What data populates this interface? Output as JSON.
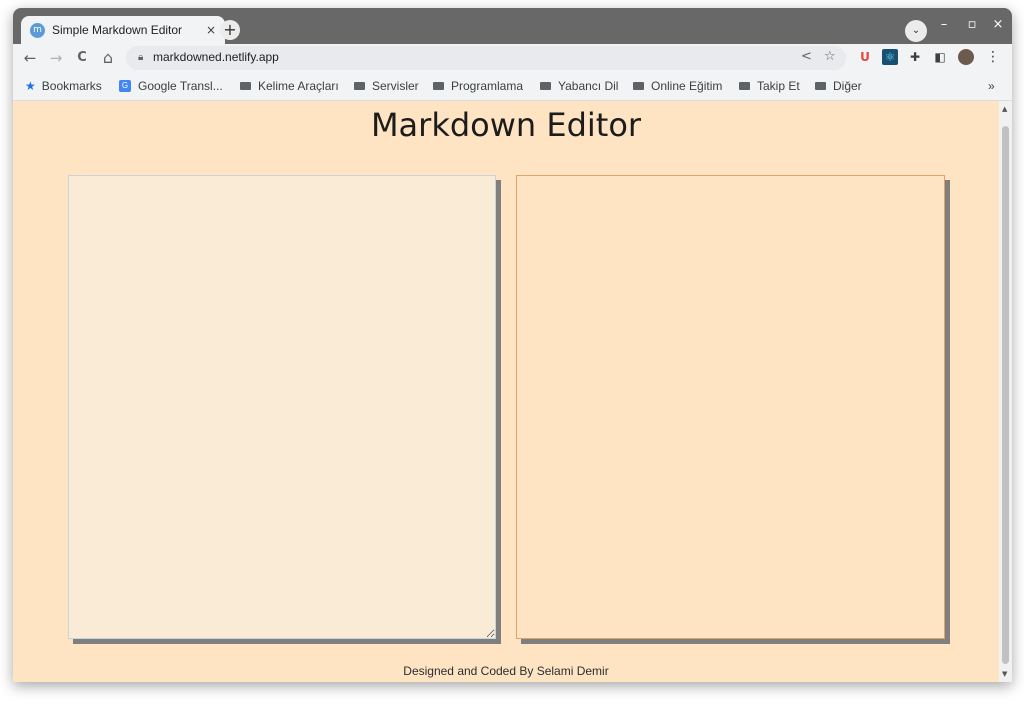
{
  "browser": {
    "tab": {
      "favicon": "m",
      "title": "Simple Markdown Editor",
      "close_glyph": "×"
    },
    "new_tab_glyph": "+",
    "tab_search_glyph": "⌄",
    "window_controls": {
      "minimize": "–",
      "maximize": "▫",
      "close": "×"
    },
    "toolbar": {
      "back_glyph": "←",
      "forward_glyph": "→",
      "reload_glyph": "C",
      "home_glyph": "⌂",
      "url": "markdowned.netlify.app",
      "share_glyph": "<",
      "bookmark_star_glyph": "☆",
      "extensions": [
        {
          "name": "ublock-icon",
          "glyph": "U",
          "color": "#e8453c"
        },
        {
          "name": "react-devtools-icon",
          "glyph": "⚛",
          "color": "#1b4f72"
        },
        {
          "name": "puzzle-extensions-icon",
          "glyph": "✚",
          "color": "#3c4043"
        },
        {
          "name": "side-panel-icon",
          "glyph": "◧",
          "color": "#3c4043"
        }
      ],
      "menu_glyph": "⋮"
    },
    "bookmarks": [
      {
        "label": "Bookmarks",
        "kind": "star"
      },
      {
        "label": "Google Transl...",
        "kind": "translate"
      },
      {
        "label": "Kelime Araçları",
        "kind": "folder"
      },
      {
        "label": "Servisler",
        "kind": "folder"
      },
      {
        "label": "Programlama",
        "kind": "folder"
      },
      {
        "label": "Yabancı Dil",
        "kind": "folder"
      },
      {
        "label": "Online Eğitim",
        "kind": "folder"
      },
      {
        "label": "Takip Et",
        "kind": "folder"
      },
      {
        "label": "Diğer",
        "kind": "folder"
      }
    ],
    "bookmarks_overflow": "»"
  },
  "page": {
    "title": "Markdown Editor",
    "editor": {
      "value": ""
    },
    "preview": {
      "content": ""
    },
    "footer": "Designed and Coded By Selami Demir",
    "colors": {
      "background": "#ffe4c4",
      "editor_background": "#faebd7",
      "preview_border": "#e2a36b",
      "shadow": "#7f7f7f"
    }
  }
}
